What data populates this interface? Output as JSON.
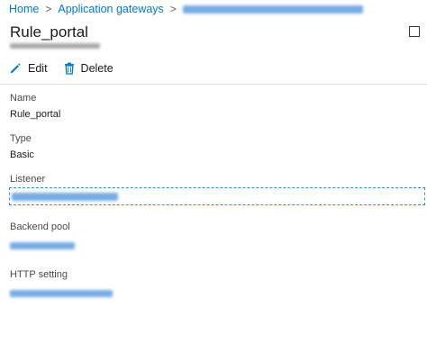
{
  "breadcrumb": {
    "home": "Home",
    "app_gateways": "Application gateways",
    "separator": ">"
  },
  "title": "Rule_portal",
  "toolbar": {
    "edit_label": "Edit",
    "delete_label": "Delete",
    "edit_icon": "pencil-icon",
    "delete_icon": "trash-icon"
  },
  "fields": {
    "name_label": "Name",
    "name_value": "Rule_portal",
    "type_label": "Type",
    "type_value": "Basic",
    "listener_label": "Listener",
    "backend_pool_label": "Backend pool",
    "http_setting_label": "HTTP setting"
  },
  "colors": {
    "accent": "#0078d4",
    "focus_dashed": "#2a8fd8"
  }
}
